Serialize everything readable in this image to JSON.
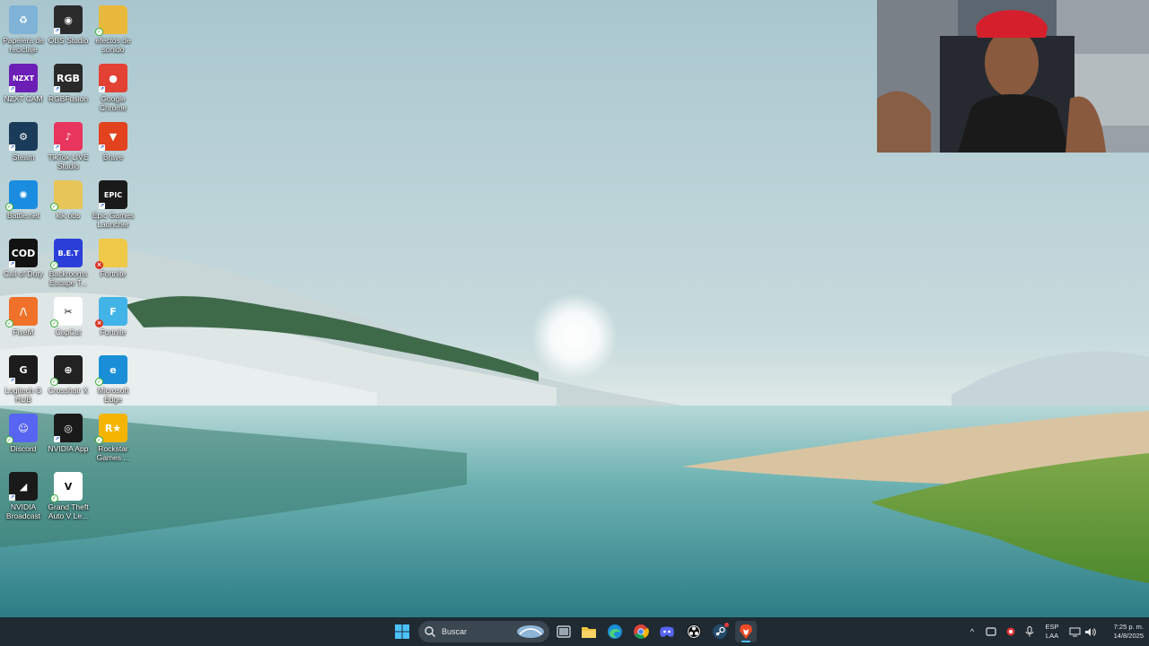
{
  "desktop": {
    "icons": [
      {
        "label": "Papelera de reciclaje",
        "icon": "recycle-bin-icon",
        "color": "#7fb3d8",
        "glyph": "♻"
      },
      {
        "label": "OBS Studio",
        "icon": "obs-studio-icon",
        "color": "#2b2b2b",
        "glyph": "◉"
      },
      {
        "label": "efectos de sonido",
        "icon": "folder-icon",
        "color": "#e8b93c",
        "glyph": ""
      },
      {
        "label": "NZXT CAM",
        "icon": "nzxt-cam-icon",
        "color": "#6c1fb6",
        "glyph": "NZXT"
      },
      {
        "label": "RGBFusion",
        "icon": "rgb-fusion-icon",
        "color": "#2a2a2a",
        "glyph": "RGB"
      },
      {
        "label": "Google Chrome",
        "icon": "chrome-icon",
        "color": "#e34133",
        "glyph": "●"
      },
      {
        "label": "Steam",
        "icon": "steam-icon",
        "color": "#1b3b5a",
        "glyph": "⚙"
      },
      {
        "label": "TikTok LIVE Studio",
        "icon": "tiktok-icon",
        "color": "#e8355d",
        "glyph": "♪"
      },
      {
        "label": "Brave",
        "icon": "brave-icon",
        "color": "#e2421d",
        "glyph": "▼"
      },
      {
        "label": "Battle.net",
        "icon": "battlenet-icon",
        "color": "#1b8de0",
        "glyph": "✺"
      },
      {
        "label": "kik obs",
        "icon": "folder-icon",
        "color": "#e8c558",
        "glyph": ""
      },
      {
        "label": "Epic Games Launcher",
        "icon": "epic-games-icon",
        "color": "#1a1a1a",
        "glyph": "EPIC"
      },
      {
        "label": "Call of Duty",
        "icon": "call-of-duty-icon",
        "color": "#121212",
        "glyph": "COD"
      },
      {
        "label": "Backrooms Escape T...",
        "icon": "backrooms-icon",
        "color": "#2b3fd8",
        "glyph": "B.E.T"
      },
      {
        "label": "Fortnite",
        "icon": "folder-icon",
        "color": "#f0c94a",
        "glyph": ""
      },
      {
        "label": "FiveM",
        "icon": "fivem-icon",
        "color": "#f0722a",
        "glyph": "/\\"
      },
      {
        "label": "CapCut",
        "icon": "capcut-icon",
        "color": "#ffffff",
        "glyph": "✂"
      },
      {
        "label": "Fortnite",
        "icon": "fortnite-icon",
        "color": "#43b4e8",
        "glyph": "F"
      },
      {
        "label": "Logitech G HUB",
        "icon": "logitech-ghub-icon",
        "color": "#1c1c1c",
        "glyph": "G"
      },
      {
        "label": "Crosshair X",
        "icon": "crosshair-x-icon",
        "color": "#222222",
        "glyph": "⊕"
      },
      {
        "label": "Microsoft Edge",
        "icon": "edge-icon",
        "color": "#1a8fd8",
        "glyph": "e"
      },
      {
        "label": "Discord",
        "icon": "discord-icon",
        "color": "#5865f2",
        "glyph": "☺"
      },
      {
        "label": "NVIDIA App",
        "icon": "nvidia-app-icon",
        "color": "#1a1a1a",
        "glyph": "◎"
      },
      {
        "label": "Rockstar Games ...",
        "icon": "rockstar-icon",
        "color": "#f4b400",
        "glyph": "R★"
      },
      {
        "label": "NVIDIA Broadcast",
        "icon": "nvidia-broadcast-icon",
        "color": "#1a1a1a",
        "glyph": "◢"
      },
      {
        "label": "Grand Theft Auto V Le...",
        "icon": "gta-v-icon",
        "color": "#ffffff",
        "glyph": "V"
      }
    ]
  },
  "taskbar": {
    "search_placeholder": "Buscar",
    "apps": [
      {
        "icon": "task-view-icon"
      },
      {
        "icon": "file-explorer-icon"
      },
      {
        "icon": "edge-icon"
      },
      {
        "icon": "chrome-icon"
      },
      {
        "icon": "discord-icon"
      },
      {
        "icon": "obs-studio-icon"
      },
      {
        "icon": "steam-icon"
      },
      {
        "icon": "brave-icon"
      }
    ],
    "tray": {
      "language_top": "ESP",
      "language_bottom": "LAA",
      "time": "7:25 p. m.",
      "date": "14/8/2025"
    }
  },
  "colors": {
    "taskbar_bg": "#1f2a33",
    "accent": "#4cc2ff"
  }
}
